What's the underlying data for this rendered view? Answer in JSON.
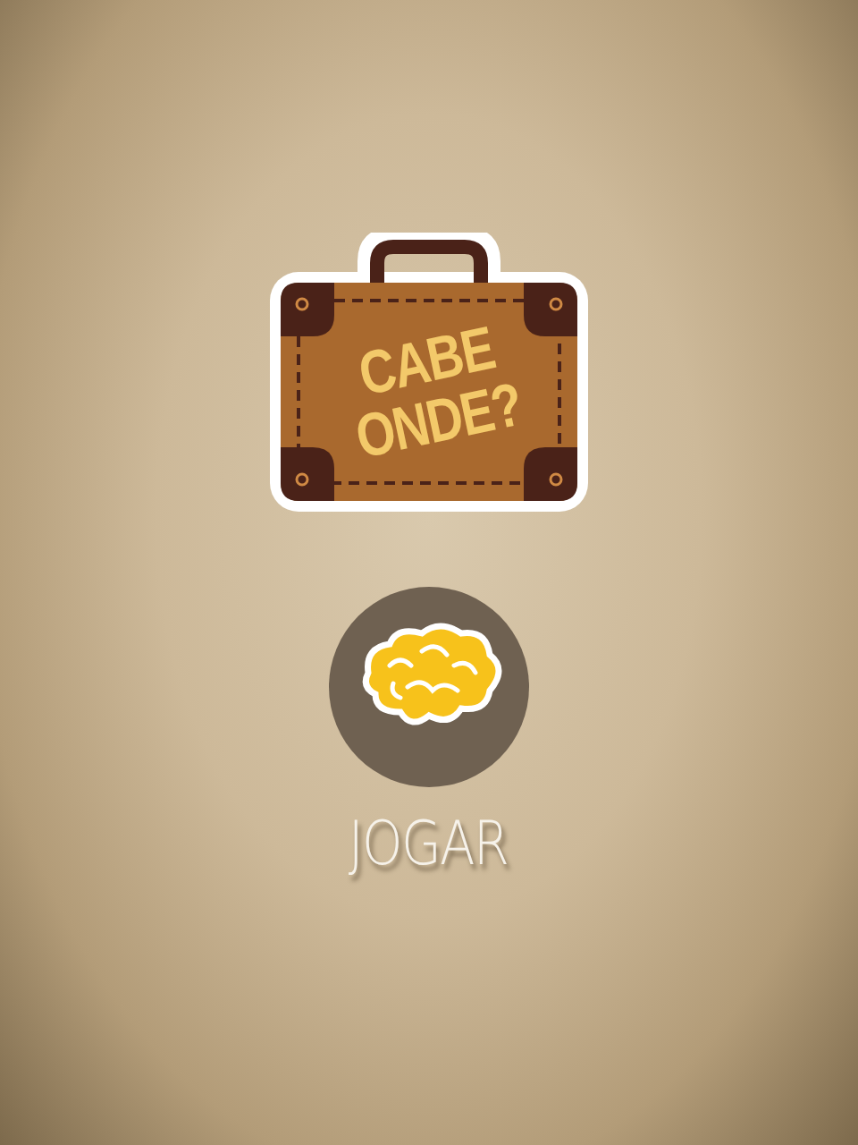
{
  "logo": {
    "lines": [
      "CABE",
      "ONDE?"
    ]
  },
  "play_button": {
    "label": "JOGAR"
  }
}
